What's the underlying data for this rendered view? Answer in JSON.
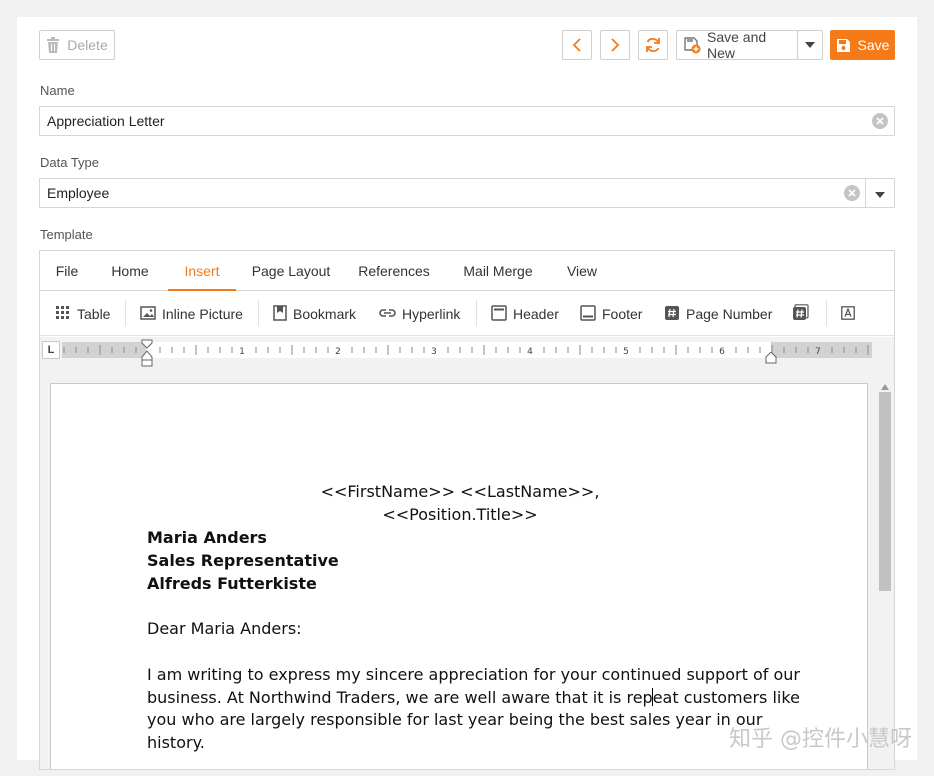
{
  "toolbar": {
    "delete_label": "Delete",
    "save_and_new_label": "Save and New",
    "save_label": "Save",
    "accent_color": "#f47b17"
  },
  "form": {
    "name_label": "Name",
    "name_value": "Appreciation Letter",
    "datatype_label": "Data Type",
    "datatype_value": "Employee",
    "template_label": "Template"
  },
  "editor": {
    "tabs": [
      {
        "label": "File"
      },
      {
        "label": "Home"
      },
      {
        "label": "Insert",
        "active": true
      },
      {
        "label": "Page Layout"
      },
      {
        "label": "References"
      },
      {
        "label": "Mail Merge"
      },
      {
        "label": "View"
      }
    ],
    "ribbon": [
      {
        "label": "Table",
        "icon": "table-icon"
      },
      {
        "label": "Inline Picture",
        "icon": "picture-icon"
      },
      {
        "label": "Bookmark",
        "icon": "bookmark-icon"
      },
      {
        "label": "Hyperlink",
        "icon": "hyperlink-icon"
      },
      {
        "label": "Header",
        "icon": "header-icon"
      },
      {
        "label": "Footer",
        "icon": "footer-icon"
      },
      {
        "label": "Page Number",
        "icon": "page-number-icon"
      },
      {
        "label": "",
        "icon": "page-count-icon"
      },
      {
        "label": "",
        "icon": "text-box-icon"
      }
    ],
    "ruler": {
      "tab_stop_label": "L",
      "numbers": [
        "1",
        "2",
        "3",
        "4",
        "5",
        "6",
        "7"
      ]
    },
    "document": {
      "merge_line_1": "<<FirstName>> <<LastName>>,",
      "merge_line_2": "<<Position.Title>>",
      "name": "Maria Anders",
      "title": "Sales Representative",
      "company": "Alfreds Futterkiste",
      "salutation": "Dear Maria Anders:",
      "body_line_1": "I am writing to express my sincere appreciation for your continued support of our",
      "body_line_2a": "business. At Northwind Traders, we are well aware that it is rep",
      "body_line_2b": "eat customers like",
      "body_line_3": "you who are largely responsible for last year being the best sales year in our",
      "body_line_4": "history."
    }
  },
  "watermark": "知乎 @控件小慧呀"
}
